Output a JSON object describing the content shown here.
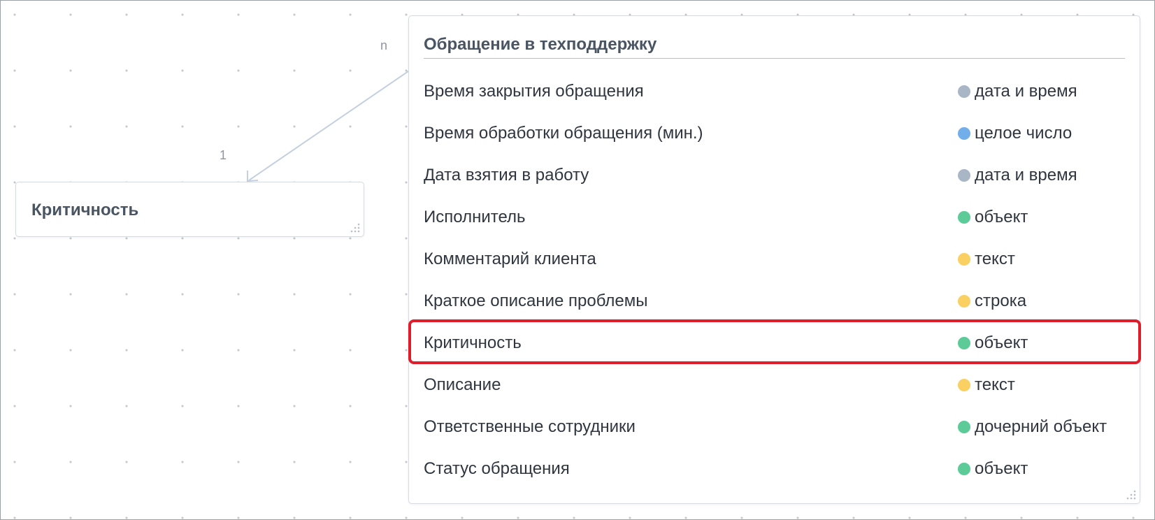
{
  "relation": {
    "source_cardinality": "n",
    "target_cardinality": "1"
  },
  "small_card": {
    "title": "Критичность"
  },
  "main_card": {
    "title": "Обращение в техподдержку",
    "fields": [
      {
        "name": "Время закрытия обращения",
        "type": "дата и время",
        "color": "#a9b6c6"
      },
      {
        "name": "Время обработки обращения (мин.)",
        "type": "целое число",
        "color": "#72aeea"
      },
      {
        "name": "Дата взятия в работу",
        "type": "дата и время",
        "color": "#a9b6c6"
      },
      {
        "name": "Исполнитель",
        "type": "объект",
        "color": "#5ccb98"
      },
      {
        "name": "Комментарий клиента",
        "type": "текст",
        "color": "#fbd062"
      },
      {
        "name": "Краткое описание проблемы",
        "type": "строка",
        "color": "#fbd062"
      },
      {
        "name": "Критичность",
        "type": "объект",
        "color": "#5ccb98",
        "highlighted": true
      },
      {
        "name": "Описание",
        "type": "текст",
        "color": "#fbd062"
      },
      {
        "name": "Ответственные сотрудники",
        "type": "дочерний объект",
        "color": "#5ccb98"
      },
      {
        "name": "Статус обращения",
        "type": "объект",
        "color": "#5ccb98"
      }
    ]
  },
  "colors": {
    "highlight": "#e01d2b",
    "title_underline": "#8fd3b7",
    "connector": "#c4d0df"
  }
}
